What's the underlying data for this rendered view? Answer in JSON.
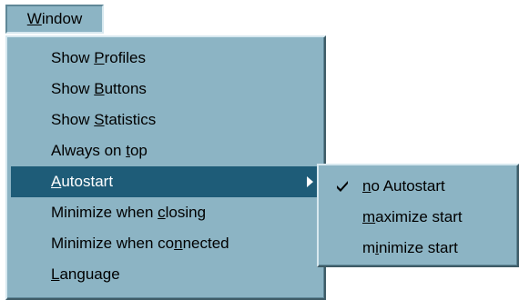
{
  "menubar": {
    "window_label": "Window",
    "window_mnemonic_index": 0
  },
  "window_menu": {
    "items": [
      {
        "label": "Show Profiles",
        "mnemonic_index": 5
      },
      {
        "label": "Show Buttons",
        "mnemonic_index": 5
      },
      {
        "label": "Show Statistics",
        "mnemonic_index": 5
      },
      {
        "label": "Always on top",
        "mnemonic_index": 10
      },
      {
        "label": "Autostart",
        "mnemonic_index": 0,
        "selected": true,
        "has_submenu": true
      },
      {
        "label": "Minimize when closing",
        "mnemonic_index": 14
      },
      {
        "label": "Minimize when connected",
        "mnemonic_index": 16
      },
      {
        "label": "Language",
        "mnemonic_index": 0
      }
    ]
  },
  "autostart_submenu": {
    "items": [
      {
        "label": "no Autostart",
        "mnemonic_index": 0,
        "checked": true
      },
      {
        "label": "maximize start",
        "mnemonic_index": 0,
        "checked": false
      },
      {
        "label": "minimize start",
        "mnemonic_index": 1,
        "checked": false
      }
    ]
  },
  "colors": {
    "menu_background": "#8cb4c4",
    "selection_background": "#1e5c78",
    "selection_text": "#ffffff",
    "text": "#000000"
  },
  "icons": {
    "submenu_arrow": "arrow-right-icon",
    "check": "check-icon"
  }
}
